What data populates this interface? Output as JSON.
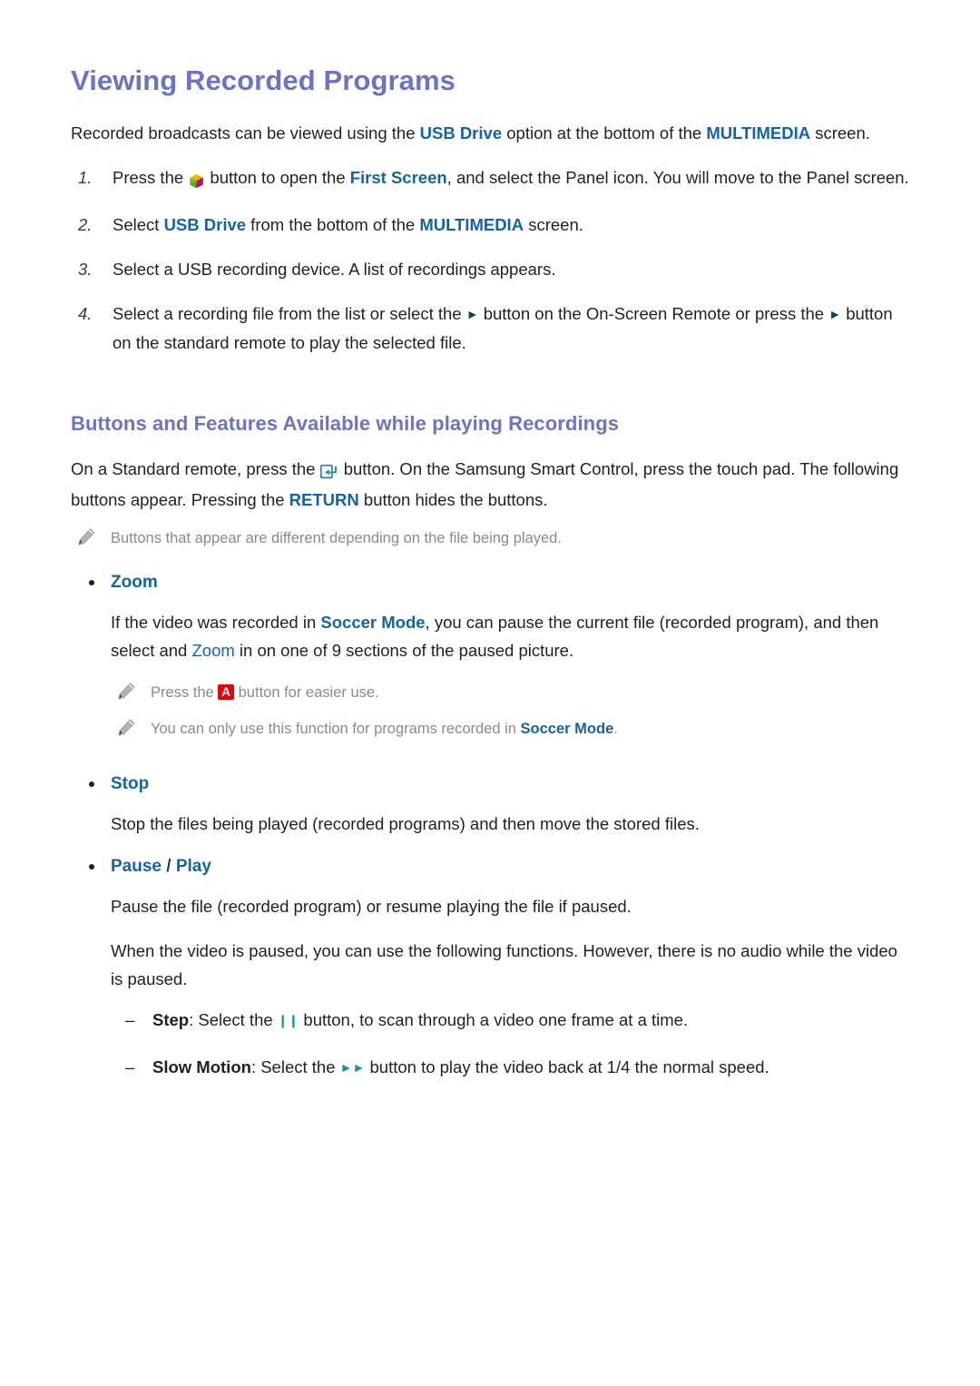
{
  "document": {
    "title": "Viewing Recorded Programs",
    "intro": {
      "part1": "Recorded broadcasts can be viewed using the ",
      "term1": "USB Drive",
      "part2": " option at the bottom of the ",
      "term2": "MULTIMEDIA",
      "part3": " screen."
    },
    "steps": [
      {
        "number": "1.",
        "text_a": "Press the ",
        "icon": "smart-hub-icon",
        "text_b": " button to open the ",
        "term1": "First Screen",
        "text_c": ", and select the Panel icon. You will move to the Panel screen."
      },
      {
        "number": "2.",
        "text_a": "Select ",
        "term1": "USB Drive",
        "text_b": " from the bottom of the ",
        "term2": "MULTIMEDIA",
        "text_c": " screen."
      },
      {
        "number": "3.",
        "text_a": "Select a USB recording device. A list of recordings appears."
      },
      {
        "number": "4.",
        "text_a": "Select a recording file from the list or select the ",
        "icon1": "play-icon",
        "text_b": " button on the On-Screen Remote or press the ",
        "icon2": "play-icon",
        "text_c": " button on the standard remote to play the selected file."
      }
    ],
    "section": {
      "title": "Buttons and Features Available while playing Recordings",
      "intro": {
        "part1": "On a Standard remote, press the ",
        "icon": "enter-key-icon",
        "part2": " button. On the Samsung Smart Control, press the touch pad. The following buttons appear. Pressing the ",
        "term1": "RETURN",
        "part3": " button hides the buttons."
      },
      "note_top": "Buttons that appear are different depending on the file being played.",
      "features": [
        {
          "label": "Zoom",
          "paragraphs": [
            {
              "part1": "If the video was recorded in ",
              "term1": "Soccer Mode",
              "part2": ", you can pause the current file (recorded program), and then select and ",
              "term2": "Zoom",
              "part3": " in on one of 9 sections of the paused picture."
            }
          ],
          "notes": [
            {
              "part1": "Press the ",
              "key": "A",
              "part2": " button for easier use."
            },
            {
              "part1": "You can only use this function for programs recorded in ",
              "term1": "Soccer Mode",
              "part2": "."
            }
          ]
        },
        {
          "label": "Stop",
          "paragraphs": [
            {
              "part1": "Stop the files being played (recorded programs) and then move the stored files."
            }
          ],
          "notes": []
        },
        {
          "label_a": "Pause",
          "label_sep": " / ",
          "label_b": "Play",
          "paragraphs": [
            {
              "part1": "Pause the file (recorded program) or resume playing the file if paused."
            },
            {
              "part1": "When the video is paused, you can use the following functions. However, there is no audio while the video is paused."
            }
          ],
          "notes": [],
          "sub_items": [
            {
              "dash": "–",
              "bold": "Step",
              "text_a": ": Select the ",
              "icon": "pause-icon",
              "text_b": " button, to scan through a video one frame at a time."
            },
            {
              "dash": "–",
              "bold": "Slow Motion",
              "text_a": ": Select the ",
              "icon": "fast-forward-icon",
              "text_b": " button to play the video back at 1/4 the normal speed."
            }
          ]
        }
      ]
    }
  },
  "colors": {
    "heading": "#6b73c4",
    "link_blue": "#1464a5",
    "note_gray": "#8a8a8a",
    "body": "#231f20",
    "teal_glyph": "#1a93a6",
    "navy_glyph": "#14415e",
    "key_a_bg": "#e3000f"
  }
}
